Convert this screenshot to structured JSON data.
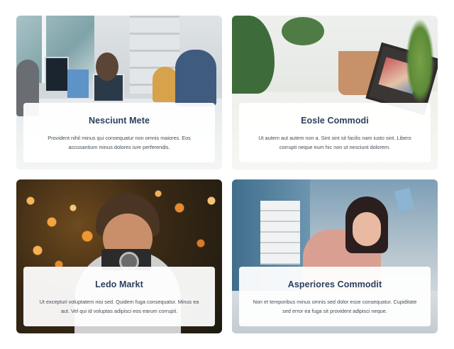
{
  "cards": [
    {
      "title": "Nesciunt Mete",
      "description": "Provident nihil minus qui consequatur non omnis maiores. Eos accusantium minus dolores iure perferendis.",
      "image": "office-team-photo"
    },
    {
      "title": "Eosle Commodi",
      "description": "Ut autem aut autem non a. Sint sint sit facilis nam iusto sint. Libero corrupti neque eum hic non ut nesciunt dolorem.",
      "image": "desk-plants-photo"
    },
    {
      "title": "Ledo Markt",
      "description": "Ut excepturi voluptatem nisi sed. Quidem fuga consequatur. Minus ea aut. Vel qui id voluptas adipisci eos earum corrupti.",
      "image": "photographer-bokeh-photo"
    },
    {
      "title": "Asperiores Commodit",
      "description": "Non et temporibus minus omnis sed dolor esse consequatur. Cupiditate sed error ea fuga sit provident adipisci neque.",
      "image": "crafting-woman-photo"
    }
  ],
  "colors": {
    "title": "#2b3f5e",
    "text": "#444b55",
    "panel": "#ffffff"
  }
}
